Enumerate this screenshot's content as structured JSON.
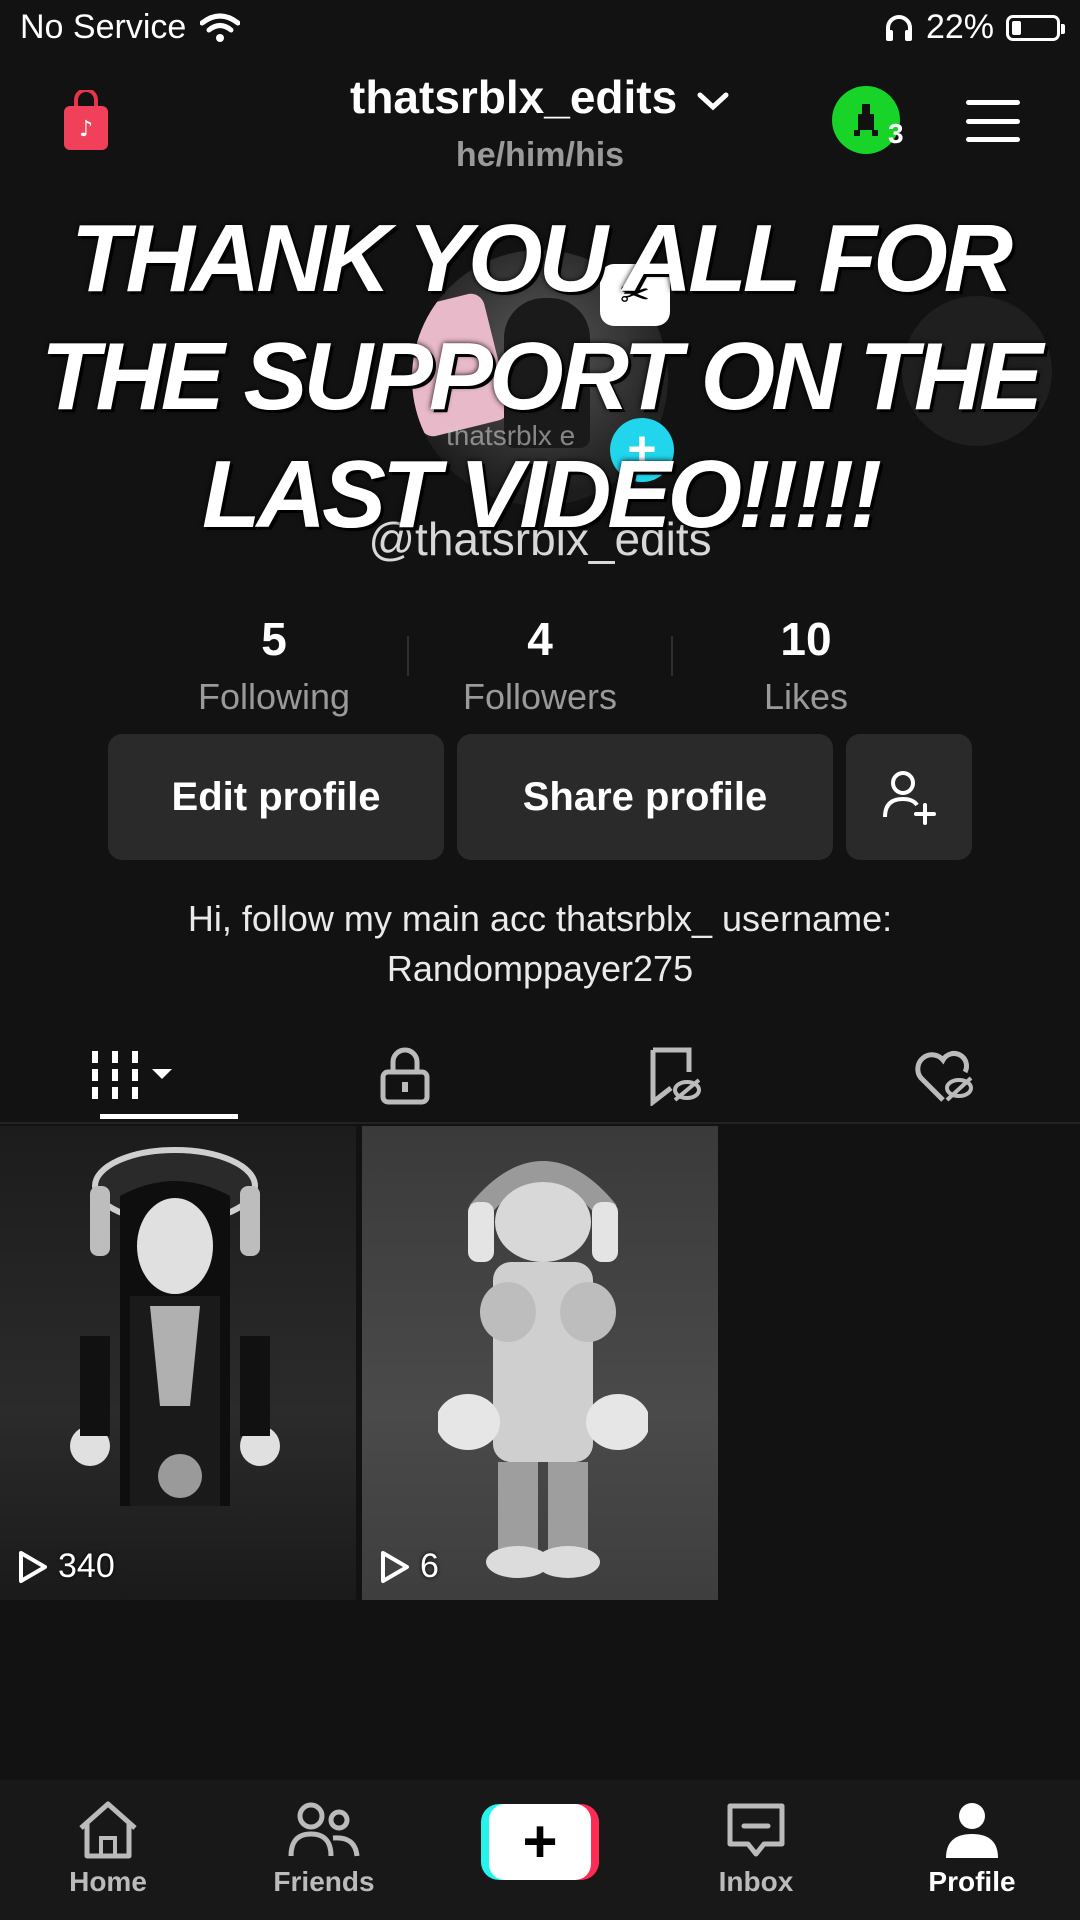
{
  "status_bar": {
    "carrier": "No Service",
    "battery_text": "22%",
    "battery_level": 0.22
  },
  "header": {
    "username": "thatsrblx_edits",
    "pronouns": "he/him/his",
    "notification_count": "3"
  },
  "overlay_caption": "THANK YOU ALL FOR THE SUPPORT ON THE LAST VIDEO!!!!!",
  "profile": {
    "photo_watermark": "thatsrblx e",
    "handle": "@thatsrblx_edits",
    "bio_line1": "Hi, follow my main acc thatsrblx_ username:",
    "bio_line2": "Randomppayer275"
  },
  "stats": [
    {
      "value": "5",
      "label": "Following"
    },
    {
      "value": "4",
      "label": "Followers"
    },
    {
      "value": "10",
      "label": "Likes"
    }
  ],
  "buttons": {
    "edit": "Edit profile",
    "share": "Share profile"
  },
  "videos": [
    {
      "views": "340"
    },
    {
      "views": "6"
    }
  ],
  "nav": {
    "home": "Home",
    "friends": "Friends",
    "inbox": "Inbox",
    "profile": "Profile"
  }
}
